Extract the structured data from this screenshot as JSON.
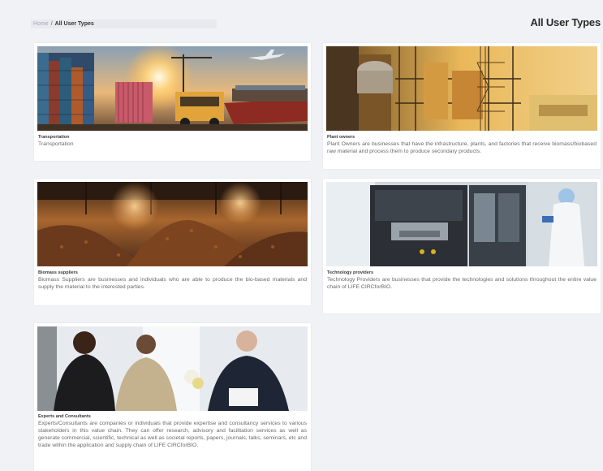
{
  "breadcrumb": {
    "home": "Home",
    "separator": "/",
    "current": "All User Types"
  },
  "page_title": "All User Types",
  "cards": [
    {
      "title": "Transportation",
      "description": "Transportation"
    },
    {
      "title": "Plant owners",
      "description": "Plant Owners are businesses that have the infrastructure, plants, and factories that receive biomass/biobased raw material and process them to produce secondary products."
    },
    {
      "title": "Biomass suppliers",
      "description": "Biomass Suppliers are businesses and individuals who are able to produce the bio-based materials and supply the material to the interested parties."
    },
    {
      "title": "Technology providers",
      "description": "Technology Providers are businesses that provide the technologies and solutions throughout the entire value chain of LIFE CIRCforBIO."
    },
    {
      "title": "Experts and Consultants",
      "description": "Experts/Consultants are companies or individuals that provide expertise and consultancy services to various stakeholders in this value chain. They can offer research, advisory and facilitation services as well as generate commercial, scientific, technical as well as societal reports, papers, journals, talks, seminars, etc and trade within the application and supply chain of LIFE CIRCforBIO."
    }
  ]
}
